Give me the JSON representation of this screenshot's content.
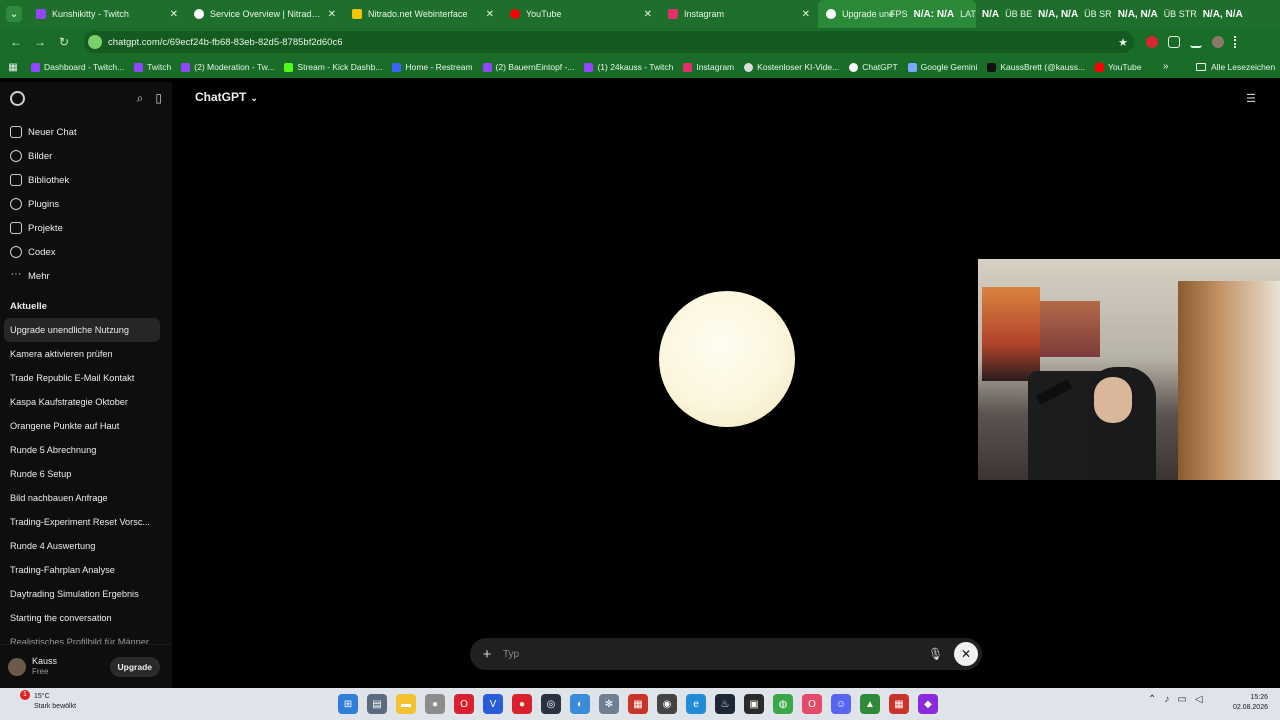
{
  "browser": {
    "tabs": [
      {
        "title": "Kunshikitty - Twitch",
        "icon_color": "#9146ff"
      },
      {
        "title": "Service Overview | Nitrado | Ni",
        "icon_color": "#ffffff"
      },
      {
        "title": "Nitrado.net Webinterface",
        "icon_color": "#f5c400"
      },
      {
        "title": "YouTube",
        "icon_color": "#ff0000"
      },
      {
        "title": "Instagram",
        "icon_color": "#e1306c"
      },
      {
        "title": "Upgrade une",
        "icon_color": "#ffffff"
      }
    ],
    "stream_overlay": {
      "fps_label": "FPS",
      "fps_value": "N/A: N/A",
      "lat_label": "LAT",
      "lat_value": "N/A",
      "ub_be_label": "ÜB BE",
      "ub_be_value": "N/A, N/A",
      "ub_sr_label": "ÜB SR",
      "ub_sr_value": "N/A, N/A",
      "ub_str_label": "ÜB STR",
      "ub_str_value": "N/A, N/A"
    },
    "url": "chatgpt.com/c/69ecf24b-fb68-83eb-82d5-8785bf2d60c6",
    "bookmarks": [
      {
        "label": "Dashboard - Twitch...",
        "icon_color": "#9146ff"
      },
      {
        "label": "Twitch",
        "icon_color": "#9146ff"
      },
      {
        "label": "(2) Moderation - Tw...",
        "icon_color": "#9146ff"
      },
      {
        "label": "Stream - Kick Dashb...",
        "icon_color": "#53fc18"
      },
      {
        "label": "Home - Restream",
        "icon_color": "#3b66f5"
      },
      {
        "label": "(2) BauernEintopf -...",
        "icon_color": "#9146ff"
      },
      {
        "label": "(1) 24kauss - Twitch",
        "icon_color": "#9146ff"
      },
      {
        "label": "Instagram",
        "icon_color": "#e1306c"
      },
      {
        "label": "Kostenloser KI-Vide...",
        "icon_color": "#dddddd"
      },
      {
        "label": "ChatGPT",
        "icon_color": "#ffffff"
      },
      {
        "label": "Google Gemini",
        "icon_color": "#7aa7ff"
      },
      {
        "label": "KaussBrett (@kauss...",
        "icon_color": "#111111"
      },
      {
        "label": "YouTube",
        "icon_color": "#ff0000"
      }
    ],
    "bookmarks_more": "»",
    "all_bookmarks": "Alle Lesezeichen"
  },
  "sidebar": {
    "nav": [
      {
        "label": "Neuer Chat",
        "icon": "edit-icon"
      },
      {
        "label": "Bilder",
        "icon": "images-icon"
      },
      {
        "label": "Bibliothek",
        "icon": "library-icon"
      },
      {
        "label": "Plugins",
        "icon": "plugins-icon"
      },
      {
        "label": "Projekte",
        "icon": "projects-icon"
      },
      {
        "label": "Codex",
        "icon": "codex-icon"
      },
      {
        "label": "Mehr",
        "icon": "more-icon"
      }
    ],
    "section_title": "Aktuelle",
    "chats": [
      "Upgrade unendliche Nutzung",
      "Kamera aktivieren prüfen",
      "Trade Republic E-Mail Kontakt",
      "Kaspa Kaufstrategie Oktober",
      "Orangene Punkte auf Haut",
      "Runde 5 Abrechnung",
      "Runde 6 Setup",
      "Bild nachbauen Anfrage",
      "Trading-Experiment Reset Vorsc...",
      "Runde 4 Auswertung",
      "Trading-Fahrplan Analyse",
      "Daytrading Simulation Ergebnis",
      "Starting the conversation",
      "Realistisches Profilbild für Männer"
    ],
    "user": {
      "name": "Kauss",
      "plan": "Free",
      "upgrade_label": "Upgrade"
    }
  },
  "main": {
    "model_name": "ChatGPT",
    "composer_placeholder": "Typ"
  },
  "taskbar": {
    "weather_temp": "15°C",
    "weather_desc": "Stark bewölkt",
    "notification_count": "1",
    "time": "15:26",
    "date": "02.08.2026"
  },
  "colors": {
    "tab_bar": "#1f6f2c",
    "sidebar_bg": "#0e0e0e",
    "main_bg": "#000000",
    "orb": "#fbf6dd"
  }
}
